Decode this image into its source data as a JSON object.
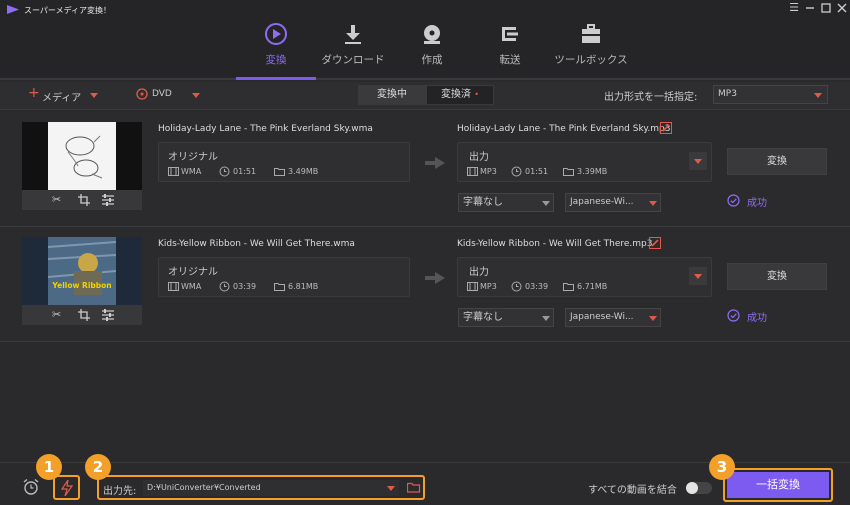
{
  "app": {
    "title": "スーパーメディア変換！"
  },
  "nav": {
    "tabs": [
      {
        "label": "変換"
      },
      {
        "label": "ダウンロード"
      },
      {
        "label": "作成"
      },
      {
        "label": "転送"
      },
      {
        "label": "ツールボックス"
      }
    ]
  },
  "toolbar": {
    "add_media": "メディア",
    "dvd": "DVD",
    "tab_converting": "変換中",
    "tab_converted": "変換済",
    "output_format_label": "出力形式を一括指定:",
    "output_format_value": "MP3"
  },
  "files": [
    {
      "source_name": "Holiday-Lady Lane - The Pink Everland Sky.wma",
      "source_label": "オリジナル",
      "source_format": "WMA",
      "source_duration": "01:51",
      "source_size": "3.49MB",
      "target_name": "Holiday-Lady Lane - The Pink Everland Sky.mp3",
      "target_label": "出力",
      "target_format": "MP3",
      "target_duration": "01:51",
      "target_size": "3.39MB",
      "subtitle": "字幕なし",
      "audio_track": "Japanese-Wi...",
      "convert_label": "変換",
      "status": "成功"
    },
    {
      "source_name": "Kids-Yellow Ribbon - We Will Get There.wma",
      "source_label": "オリジナル",
      "source_format": "WMA",
      "source_duration": "03:39",
      "source_size": "6.81MB",
      "target_name": "Kids-Yellow Ribbon - We Will Get There.mp3",
      "target_label": "出力",
      "target_format": "MP3",
      "target_duration": "03:39",
      "target_size": "6.71MB",
      "subtitle": "字幕なし",
      "audio_track": "Japanese-Wi...",
      "convert_label": "変換",
      "status": "成功",
      "thumb_caption": "Yellow Ribbon"
    }
  ],
  "bottom": {
    "badge1": "1",
    "badge2": "2",
    "badge3": "3",
    "output_label": "出力先:",
    "output_path": "D:¥UniConverter¥Converted",
    "merge_label": "すべての動画を結合",
    "convert_all": "一括変換"
  },
  "colors": {
    "accent": "#7d5af0",
    "highlight": "#f2a02a",
    "danger": "#e05a4a"
  }
}
